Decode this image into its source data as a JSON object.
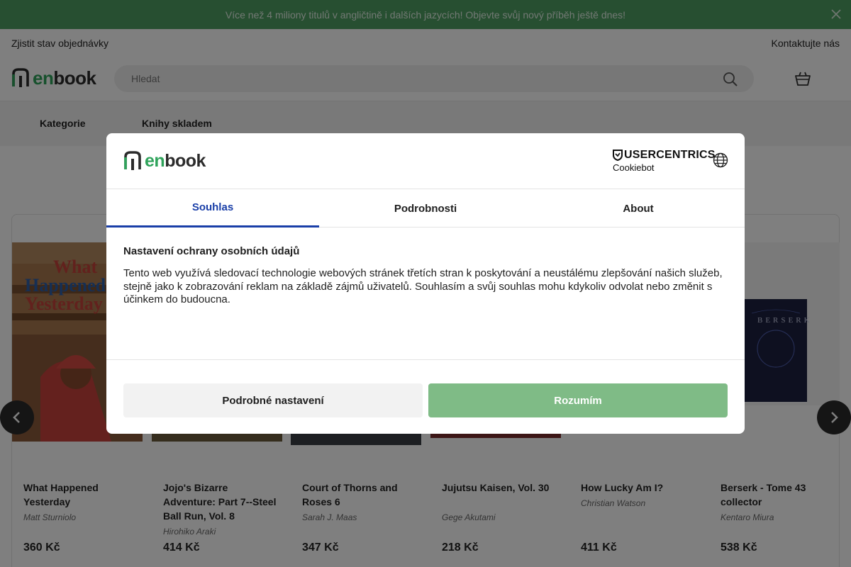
{
  "promo": {
    "text": "Více než 4 miliony titulů v angličtině i dalších jazycích! Objevte svůj nový příběh ještě dnes!"
  },
  "topbar": {
    "order_status": "Zjistit stav objednávky",
    "contact": "Kontaktujte nás"
  },
  "header": {
    "logo_en": "en",
    "logo_book": "book",
    "search_placeholder": "Hledat"
  },
  "nav": {
    "items": [
      "Kategorie",
      "Knihy skladem"
    ]
  },
  "products": [
    {
      "title": "What Happened Yesterday",
      "author": "Matt Sturniolo",
      "price": "360 Kč"
    },
    {
      "title": "Jojo's Bizarre Adventure: Part 7--Steel Ball Run, Vol. 8",
      "author": "Hirohiko Araki",
      "price": "414 Kč"
    },
    {
      "title": "Court of Thorns and Roses 6",
      "author": "Sarah J. Maas",
      "price": "347 Kč"
    },
    {
      "title": "Jujutsu Kaisen, Vol. 30",
      "author": "Gege Akutami",
      "price": "218 Kč"
    },
    {
      "title": "How Lucky Am I?",
      "author": "Christian Watson",
      "price": "411 Kč"
    },
    {
      "title": "Berserk - Tome 43 collector",
      "author": "Kentaro Miura",
      "price": "538 Kč"
    }
  ],
  "covers": {
    "what_happened_line1": "What",
    "what_happened_line2": "Happened",
    "what_happened_line3": "Yesterday",
    "berserk_spine": "BERSERK"
  },
  "dialog": {
    "logo_en": "en",
    "logo_book": "book",
    "uc_line1": "USERCENTRICS",
    "uc_line2": "Cookiebot",
    "tabs": [
      "Souhlas",
      "Podrobnosti",
      "About"
    ],
    "title": "Nastavení ochrany osobních údajů",
    "text": "Tento web využívá sledovací technologie webových stránek třetích stran k poskytování a neustálému zlepšování našich služeb, stejně jako k zobrazování reklam na základě zájmů uživatelů. Souhlasím a svůj souhlas mohu kdykoliv odvolat nebo změnit s účinkem do budoucna.",
    "btn_details": "Podrobné nastavení",
    "btn_accept": "Rozumím"
  },
  "colors": {
    "brand_green": "#2fa35b",
    "accent_blue": "#1a3fa8",
    "accept_button": "#7fbb86",
    "promo_bg": "#4f9e62"
  },
  "icons": [
    "close-icon",
    "search-icon",
    "cart-icon",
    "globe-icon",
    "shield-icon",
    "chevron-left-icon",
    "chevron-right-icon"
  ]
}
